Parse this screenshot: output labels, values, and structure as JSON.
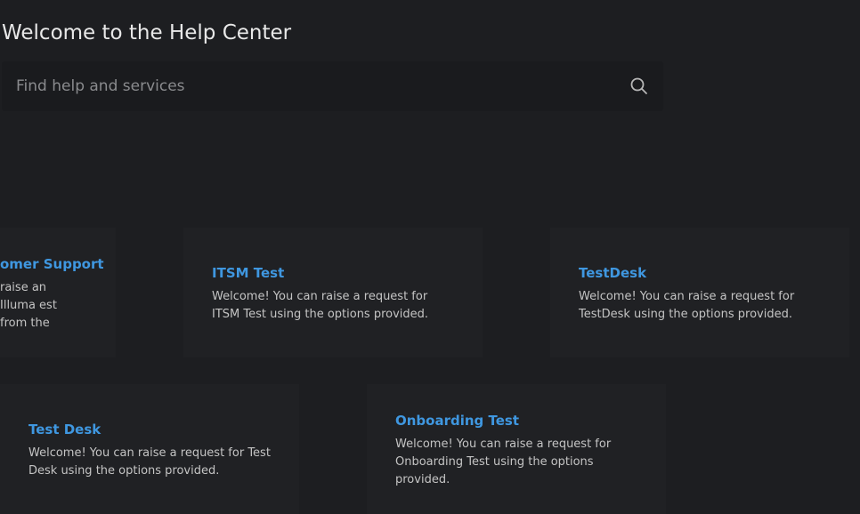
{
  "page": {
    "title": "Welcome to the Help Center"
  },
  "search": {
    "placeholder": "Find help and services",
    "icon": "search-icon"
  },
  "colors": {
    "background": "#1d1e21",
    "card": "#202124",
    "link": "#3f97e0"
  },
  "cards": [
    {
      "title": "omer Support",
      "description": "raise an Illuma est from the"
    },
    {
      "title": "ITSM Test",
      "description": "Welcome! You can raise a request for ITSM Test using the options provided."
    },
    {
      "title": "TestDesk",
      "description": "Welcome! You can raise a request for TestDesk using the options provided."
    },
    {
      "title": "Test Desk",
      "description": "Welcome! You can raise a request for Test Desk using the options provided."
    },
    {
      "title": "Onboarding Test",
      "description": "Welcome! You can raise a request for Onboarding Test using the options provided."
    }
  ]
}
